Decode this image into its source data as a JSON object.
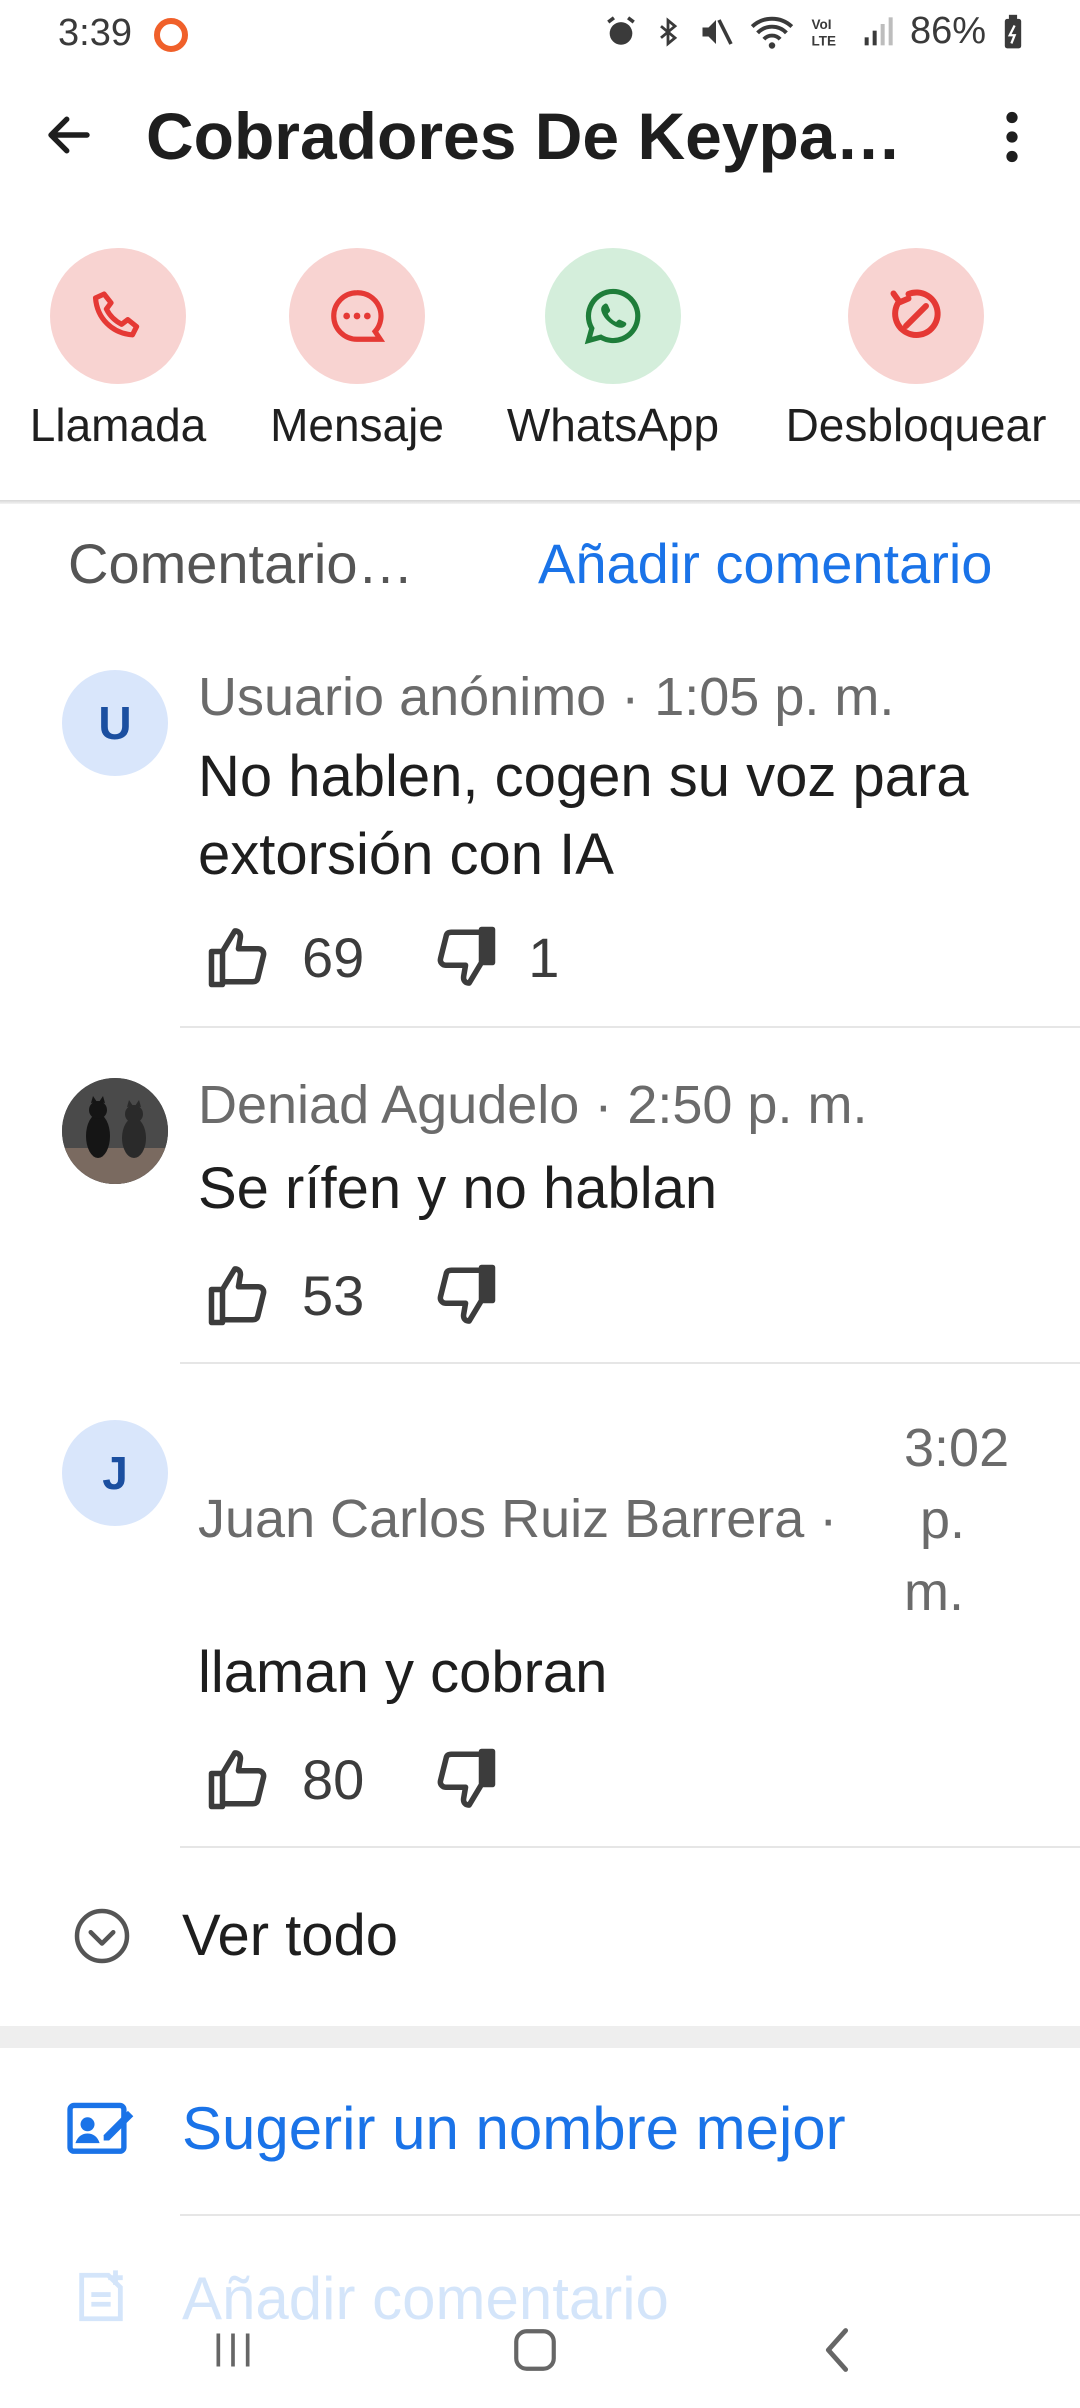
{
  "status_bar": {
    "time": "3:39",
    "battery": "86%"
  },
  "appbar": {
    "title": "Cobradores De Keypa…"
  },
  "actions": [
    {
      "label": "Llamada",
      "icon": "phone-icon",
      "color": "#e53935"
    },
    {
      "label": "Mensaje",
      "icon": "chat-icon",
      "color": "#e53935"
    },
    {
      "label": "WhatsApp",
      "icon": "whatsapp-icon",
      "color": "#1e7d3a"
    },
    {
      "label": "Desbloquear",
      "icon": "unblock-icon",
      "color": "#e53935"
    }
  ],
  "comments_section": {
    "title": "Comentario…",
    "add_link": "Añadir comentario",
    "comments": [
      {
        "avatar": "U",
        "author": "Usuario anónimo",
        "sep": " · ",
        "time": "1:05 p. m.",
        "text": "No hablen, cogen su voz para extorsión con IA",
        "likes": "69",
        "dislikes": "1"
      },
      {
        "avatar": "photo",
        "author": "Deniad Agudelo",
        "sep": " · ",
        "time": "2:50 p. m.",
        "text": "Se rífen y no hablan",
        "likes": "53",
        "dislikes": ""
      },
      {
        "avatar": "J",
        "author": "Juan Carlos Ruiz Barrera",
        "sep": " ·",
        "time_lines": [
          "3:02",
          "p.",
          "m."
        ],
        "text": "llaman y cobran",
        "likes": "80",
        "dislikes": ""
      }
    ],
    "see_all": "Ver todo"
  },
  "suggest": {
    "label": "Sugerir un nombre mejor"
  },
  "faded_row": {
    "label": "Añadir comentario"
  },
  "colors": {
    "accent": "#1a73e8",
    "pink_bg": "#f8d3d1",
    "green_bg": "#d4eedb"
  }
}
